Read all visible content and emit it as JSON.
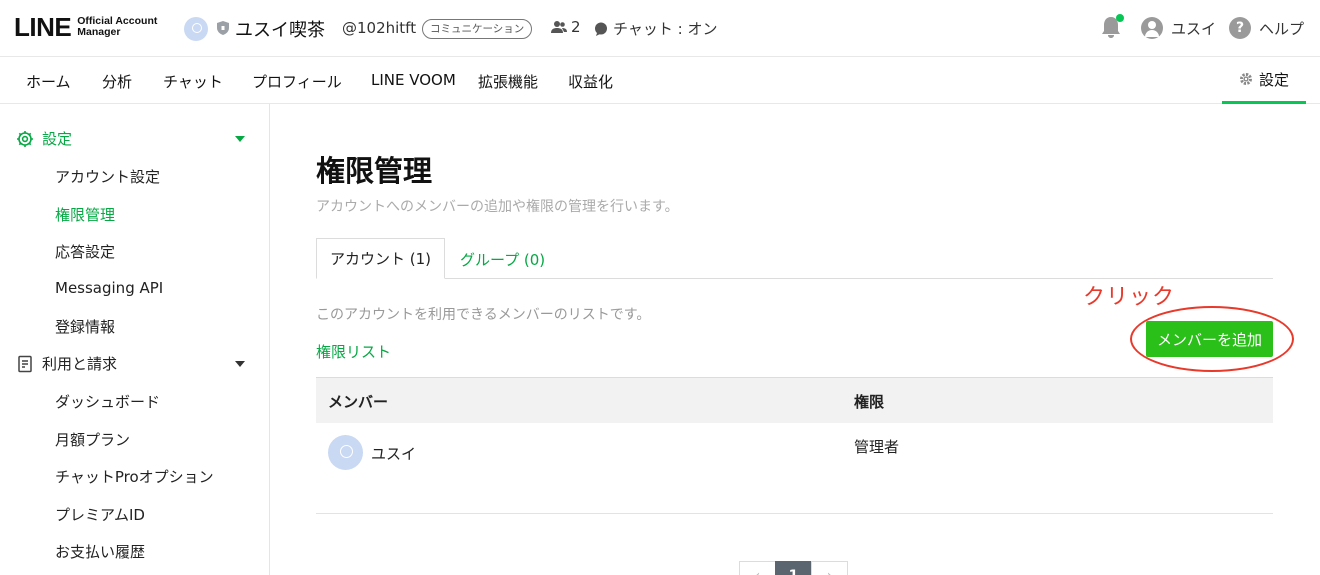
{
  "header": {
    "logo_main": "LINE",
    "logo_sub_line1": "Official Account",
    "logo_sub_line2": "Manager",
    "account_name": "ユスイ喫茶",
    "account_id": "@102hitft",
    "category": "コミュニケーション",
    "friend_count": "2",
    "chat_status": "チャット : オン",
    "user_name": "ユスイ",
    "help_label": "ヘルプ"
  },
  "nav": {
    "items": [
      "ホーム",
      "分析",
      "チャット",
      "プロフィール",
      "LINE VOOM",
      "拡張機能",
      "収益化"
    ],
    "settings_label": "設定"
  },
  "sidebar": {
    "settings_section": "設定",
    "settings_items": [
      "アカウント設定",
      "権限管理",
      "応答設定",
      "Messaging API",
      "登録情報"
    ],
    "billing_section": "利用と請求",
    "billing_items": [
      "ダッシュボード",
      "月額プラン",
      "チャットProオプション",
      "プレミアムID",
      "お支払い履歴"
    ],
    "active_item": "権限管理"
  },
  "main": {
    "title": "権限管理",
    "subtitle": "アカウントへのメンバーの追加や権限の管理を行います。",
    "tabs": [
      {
        "label": "アカウント (1)",
        "active": true
      },
      {
        "label": "グループ (0)",
        "active": false
      }
    ],
    "list_description": "このアカウントを利用できるメンバーのリストです。",
    "permission_list_link": "権限リスト",
    "add_member_button": "メンバーを追加",
    "annotation": "クリック",
    "table": {
      "headers": [
        "メンバー",
        "権限"
      ],
      "rows": [
        {
          "member": "ユスイ",
          "role": "管理者"
        }
      ]
    },
    "pagination": {
      "current_page": "1"
    }
  },
  "colors": {
    "line_green": "#06c755",
    "button_green": "#2bbf1a",
    "annotation_red": "#e8392b"
  }
}
